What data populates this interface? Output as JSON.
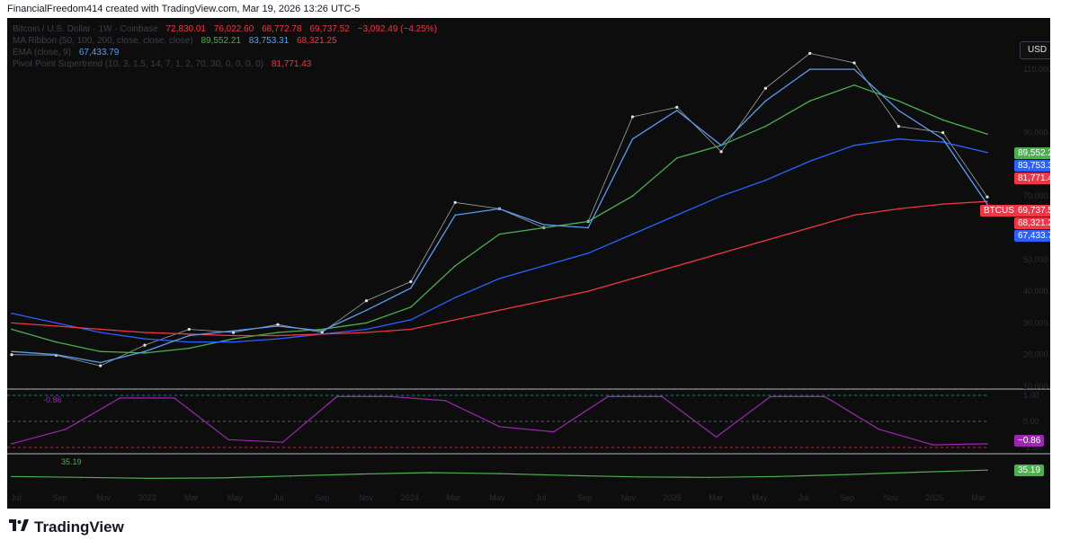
{
  "header": "FinancialFreedom414 created with TradingView.com, Mar 19, 2026 13:26 UTC-5",
  "currency": "USD",
  "legend": {
    "row1": {
      "label": "Bitcoin / U.S. Dollar · 1W · Coinbase",
      "o": "72,830.01",
      "h": "76,022.60",
      "l": "68,772.78",
      "c": "69,737.52",
      "chg": "−3,092.49 (−4.25%)"
    },
    "row2": {
      "label": "MA Ribbon (50, 100, 200, close, close, close)",
      "v1": "89,552.21",
      "v2": "83,753.31",
      "v3": "68,321.25"
    },
    "row3": {
      "label": "EMA (close, 9)",
      "v1": "67,433.79"
    },
    "row4": {
      "label": "Pivot Point Supertrend (10, 3, 1.5, 14, 7, 1, 2, 70, 30, 0, 0, 0, 0)",
      "v1": "81,771.43"
    }
  },
  "price_tags": [
    {
      "text": "89,552.21",
      "color": "#4caf50"
    },
    {
      "text": "83,753.31",
      "color": "#2962ff"
    },
    {
      "text": "81,771.43",
      "color": "#f23645"
    },
    {
      "text": "BTCUSD",
      "color": "#f23645"
    },
    {
      "text": "69,737.52",
      "color": "#f23645"
    },
    {
      "text": "68,321.25",
      "color": "#f23645"
    },
    {
      "text": "67,433.79",
      "color": "#2962ff"
    }
  ],
  "price_axis_labels": [
    "110,000.00",
    "90,000.00",
    "80,000.00",
    "70,000.00",
    "60,000.00",
    "50,000.00",
    "40,000.00",
    "30,000.00",
    "20,000.00",
    "10,000.00"
  ],
  "osc1": {
    "label": "-0.86",
    "tag": "−0.86",
    "axis": [
      "1.00",
      "0.00",
      "-1.00"
    ],
    "color": "#9c27b0"
  },
  "osc2": {
    "label": "35.19",
    "tag": "35.19",
    "color": "#4caf50"
  },
  "time_axis": [
    "Jul",
    "Sep",
    "Nov",
    "2023",
    "Mar",
    "May",
    "Jul",
    "Sep",
    "Nov",
    "2024",
    "Mar",
    "May",
    "Jul",
    "Sep",
    "Nov",
    "2025",
    "Mar",
    "May",
    "Jul",
    "Sep",
    "Nov",
    "2026",
    "Mar"
  ],
  "footer": "TradingView",
  "chart_data": {
    "type": "line",
    "ylim": [
      10000,
      112000
    ],
    "price_x": [
      "Jul 2022",
      "Sep 2022",
      "Nov 2022",
      "Jan 2023",
      "Mar 2023",
      "May 2023",
      "Jul 2023",
      "Sep 2023",
      "Nov 2023",
      "Jan 2024",
      "Mar 2024",
      "May 2024",
      "Jul 2024",
      "Sep 2024",
      "Nov 2024",
      "Jan 2025",
      "Mar 2025",
      "May 2025",
      "Jul 2025",
      "Sep 2025",
      "Nov 2025",
      "Jan 2026",
      "Mar 2026"
    ],
    "series": [
      {
        "name": "BTCUSD",
        "color": "#e0e3eb",
        "values": [
          20000,
          19800,
          16500,
          23000,
          28000,
          27000,
          29500,
          27000,
          37000,
          43000,
          68000,
          66000,
          60000,
          62000,
          95000,
          98000,
          84000,
          104000,
          115000,
          112000,
          92000,
          90000,
          69737
        ]
      },
      {
        "name": "MA 50",
        "color": "#4caf50",
        "values": [
          28000,
          24000,
          21000,
          20500,
          22000,
          25000,
          27000,
          28000,
          30000,
          35000,
          48000,
          58000,
          60000,
          62000,
          70000,
          82000,
          86000,
          92000,
          100000,
          105000,
          100000,
          94000,
          89552
        ]
      },
      {
        "name": "MA 100",
        "color": "#2962ff",
        "values": [
          33000,
          30000,
          27000,
          25000,
          24000,
          24000,
          25000,
          26500,
          28000,
          31000,
          38000,
          44000,
          48000,
          52000,
          58000,
          64000,
          70000,
          75000,
          81000,
          86000,
          88000,
          87000,
          83753
        ]
      },
      {
        "name": "MA 200",
        "color": "#f23645",
        "values": [
          30000,
          29000,
          28000,
          27000,
          26500,
          26000,
          26000,
          26500,
          27000,
          28000,
          31000,
          34000,
          37000,
          40000,
          44000,
          48000,
          52000,
          56000,
          60000,
          64000,
          66000,
          67500,
          68321
        ]
      },
      {
        "name": "EMA 9",
        "color": "#5b9cf6",
        "values": [
          21000,
          20000,
          17500,
          21000,
          26000,
          27500,
          29000,
          27500,
          34000,
          41000,
          64000,
          66000,
          61000,
          60000,
          88000,
          97000,
          86000,
          100000,
          110000,
          110000,
          97000,
          88000,
          67433
        ]
      }
    ],
    "oscillator_1": {
      "values": [
        -0.86,
        -0.3,
        0.9,
        0.9,
        -0.7,
        -0.8,
        0.95,
        0.95,
        0.8,
        -0.2,
        -0.4,
        0.95,
        0.95,
        -0.6,
        0.95,
        0.95,
        -0.3,
        -0.9,
        -0.86
      ],
      "ylim": [
        -1,
        1
      ]
    },
    "oscillator_2": {
      "values": [
        22,
        20,
        18,
        19,
        23,
        27,
        30,
        28,
        24,
        21,
        20,
        22,
        26,
        31,
        35.19
      ],
      "ylim": [
        0,
        60
      ]
    }
  }
}
